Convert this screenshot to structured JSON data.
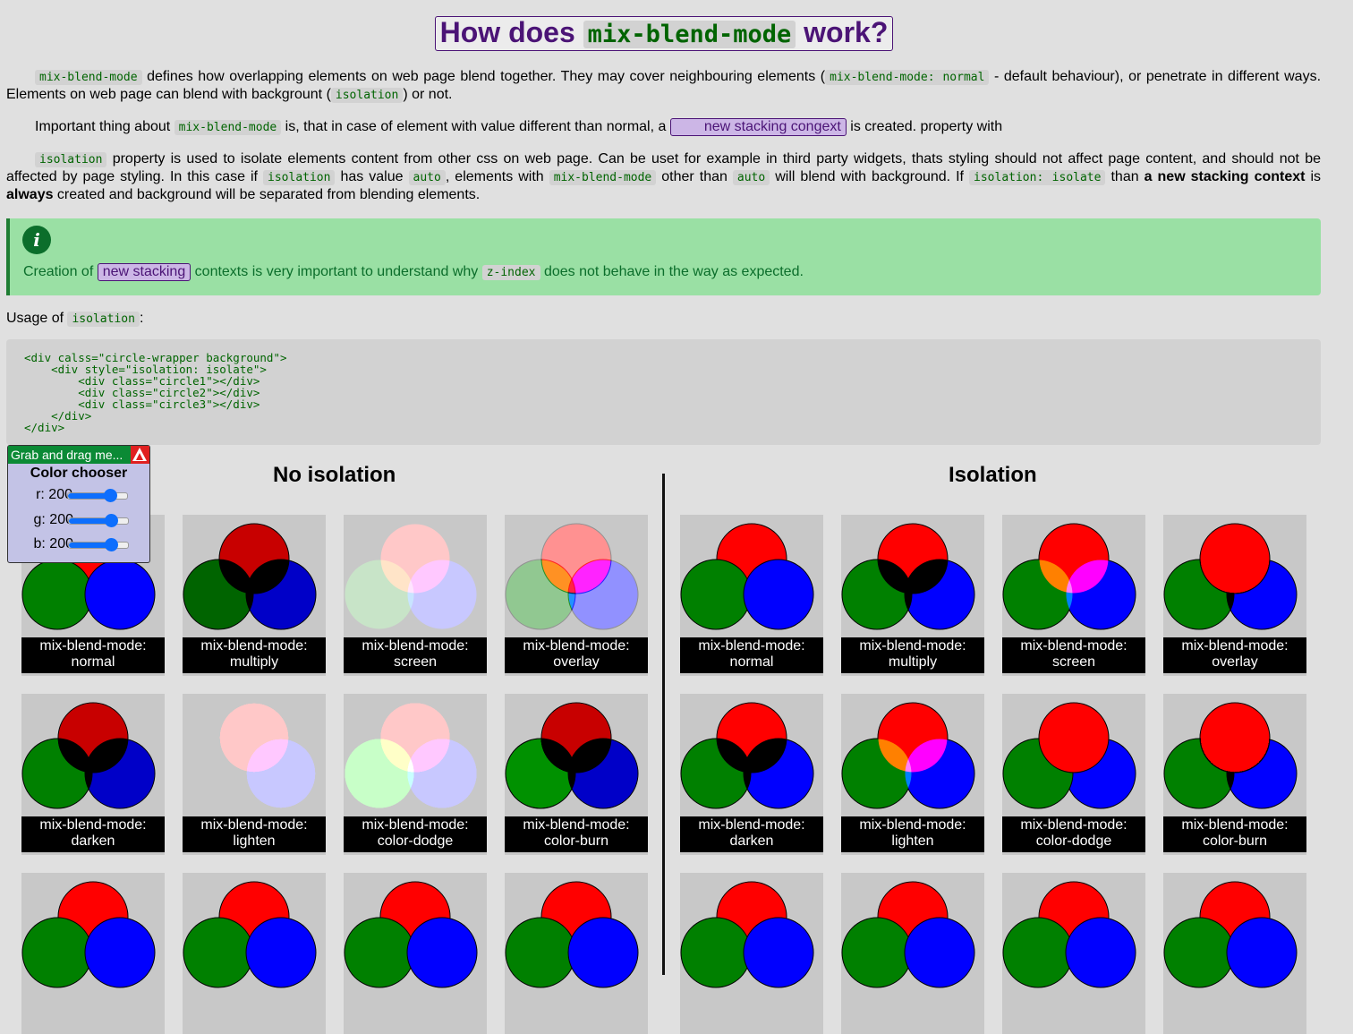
{
  "title": {
    "pre": "How does ",
    "code": "mix-blend-mode",
    "post": " work?"
  },
  "p1": {
    "c1": "mix-blend-mode",
    "t1": " defines how overlapping elements on web page blend together. They may cover neighbouring elements (",
    "c2": "mix-blend-mode: normal",
    "t2": " - default behaviour), or penetrate in different ways. Elements on web page can blend with backgrount (",
    "c3": "isolation",
    "t3": ") or not."
  },
  "p2": {
    "t1": "Important thing about ",
    "c1": "mix-blend-mode",
    "t2": " is, that in case of element with value different than normal, a ",
    "link": "new stacking congext",
    "t3": " is created. property with"
  },
  "p3": {
    "c1": "isolation",
    "t1": " property is used to isolate elements content from other css on web page. Can be uset for example in third party widgets, thats styling should not affect page content, and should not be affected by page styling. In this case if ",
    "c2": "isolation",
    "t2": " has value ",
    "c3": "auto",
    "t3": ", elements with ",
    "c4": "mix-blend-mode",
    "t4": " other than ",
    "c5": "auto",
    "t5": " will blend with background. If ",
    "c6": "isolation: isolate",
    "t6": " than ",
    "b1": "a new stacking context",
    "t7": " is ",
    "b2": "always",
    "t8": " created and background will be separated from blending elements."
  },
  "info": {
    "icon": "info-icon",
    "t1": "Creation of ",
    "link": "new stacking",
    "t2": " contexts is very important to understand why ",
    "c1": "z-index",
    "t3": " does not behave in the way as expected."
  },
  "usage": {
    "t1": "Usage of ",
    "c1": "isolation",
    "t2": ":"
  },
  "code_sample": "<div calss=\"circle-wrapper background\">\n    <div style=\"isolation: isolate\">\n        <div class=\"circle1\"></div>\n        <div class=\"circle2\"></div>\n        <div class=\"circle3\"></div>\n    </div>\n</div>",
  "sections": {
    "left": "No isolation",
    "right": "Isolation"
  },
  "label_prefix": "mix-blend-mode:",
  "modes": [
    "normal",
    "multiply",
    "screen",
    "overlay",
    "darken",
    "lighten",
    "color-dodge",
    "color-burn",
    "",
    "",
    "",
    ""
  ],
  "colors": {
    "background": "#c8c8c8",
    "red": "#ff0000",
    "green": "#008000",
    "blue": "#0000ff"
  },
  "chooser": {
    "header": "Grab and drag me...",
    "title": "Color chooser",
    "collapse_icon": "warning-triangle-icon",
    "sliders": [
      {
        "label": "r: 200",
        "value": 200,
        "max": 255
      },
      {
        "label": "g: 200",
        "value": 200,
        "max": 255
      },
      {
        "label": "b: 200",
        "value": 200,
        "max": 255
      }
    ]
  }
}
